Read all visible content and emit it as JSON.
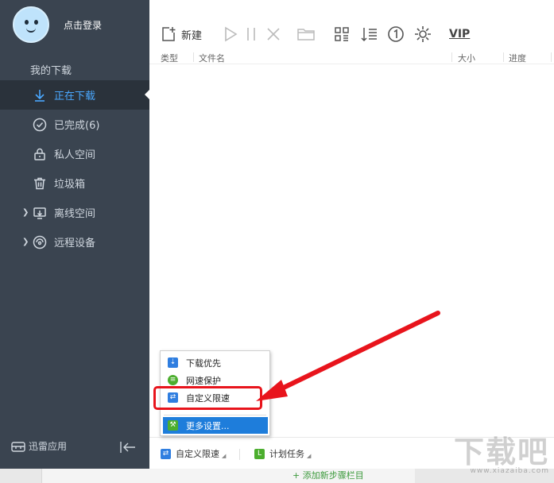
{
  "sidebar": {
    "login_text": "点击登录",
    "section_title": "我的下载",
    "items": [
      {
        "label": "正在下载",
        "icon": "download-arrow-icon",
        "active": true
      },
      {
        "label": "已完成(6)",
        "icon": "check-circle-icon"
      },
      {
        "label": "私人空间",
        "icon": "lock-icon"
      },
      {
        "label": "垃圾箱",
        "icon": "trash-icon"
      },
      {
        "label": "离线空间",
        "icon": "cloud-download-icon",
        "expandable": true
      },
      {
        "label": "远程设备",
        "icon": "remote-device-icon",
        "expandable": true
      }
    ],
    "apps_label": "迅雷应用"
  },
  "toolbar": {
    "new_label": "新建",
    "vip_label": "VIP",
    "icons": [
      "new-icon",
      "play-icon",
      "pause-icon",
      "delete-icon",
      "folder-icon",
      "grid-view-icon",
      "sort-icon",
      "single-task-icon",
      "settings-icon"
    ]
  },
  "columns": {
    "type": "类型",
    "filename": "文件名",
    "size": "大小",
    "progress": "进度"
  },
  "menu": {
    "items": [
      {
        "label": "下载优先",
        "icon": "download-priority-icon",
        "color": "#2f7ee0"
      },
      {
        "label": "网速保护",
        "icon": "speed-protect-icon",
        "color": "#4cae2e"
      },
      {
        "label": "自定义限速",
        "icon": "custom-speed-icon",
        "color": "#2f7ee0"
      },
      {
        "label": "更多设置...",
        "icon": "wrench-icon",
        "color": "#4cae2e",
        "highlighted": true
      }
    ]
  },
  "bottom_bar": {
    "speed_mode": "自定义限速",
    "schedule": "计划任务"
  },
  "strip": {
    "add_tag": "+ 添加新步骤栏目"
  },
  "watermark": {
    "logo": "下载吧",
    "url": "www.xiazaiba.com"
  },
  "colors": {
    "sidebar_bg": "#3a4450",
    "active_bg": "#2a323b",
    "accent": "#4aa8ff",
    "menu_highlight": "#1e7ddb",
    "annotation_red": "#e8141c"
  }
}
